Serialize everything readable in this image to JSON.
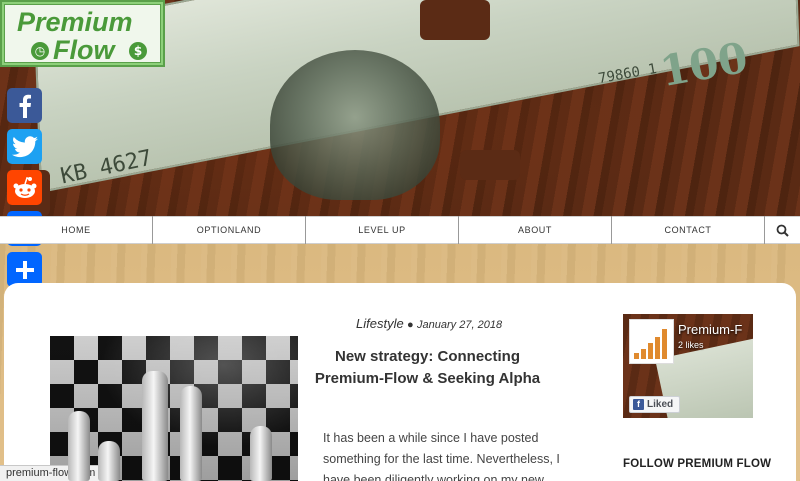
{
  "logo": {
    "line1": "Premium",
    "line2": "Flow",
    "clock_symbol": "◷",
    "dollar_symbol": "$"
  },
  "banner": {
    "serial_left": "KB 4627",
    "serial_right": "79860 1",
    "denomination": "100"
  },
  "share": {
    "items": [
      {
        "name": "facebook",
        "glyph": "f",
        "color": "#3b5998"
      },
      {
        "name": "twitter",
        "glyph": "t",
        "color": "#1da1f2"
      },
      {
        "name": "reddit",
        "glyph": "r",
        "color": "#ff4500"
      },
      {
        "name": "email",
        "glyph": "✉",
        "color": "#0166ff"
      },
      {
        "name": "share",
        "glyph": "+",
        "color": "#0166ff"
      }
    ]
  },
  "nav": {
    "items": [
      "HOME",
      "OPTIONLAND",
      "LEVEL UP",
      "ABOUT",
      "CONTACT"
    ],
    "search_icon": "search-icon"
  },
  "post": {
    "category": "Lifestyle",
    "separator": "●",
    "date": "January 27, 2018",
    "title": "New strategy: Connecting Premium-Flow & Seeking Alpha",
    "excerpt": "It has been a while since I have posted something for the last time. Nevertheless, I have been diligently working on my new"
  },
  "facebook_box": {
    "name": "Premium-F",
    "likes": "2 likes",
    "like_button": "Liked"
  },
  "sidebar": {
    "follow_heading": "FOLLOW PREMIUM FLOW"
  },
  "status_bar": {
    "url": "premium-flow.com"
  },
  "colors": {
    "brand_green": "#4a9a3a",
    "logo_bg": "#8dd07a",
    "fb_blue": "#3b5998"
  }
}
